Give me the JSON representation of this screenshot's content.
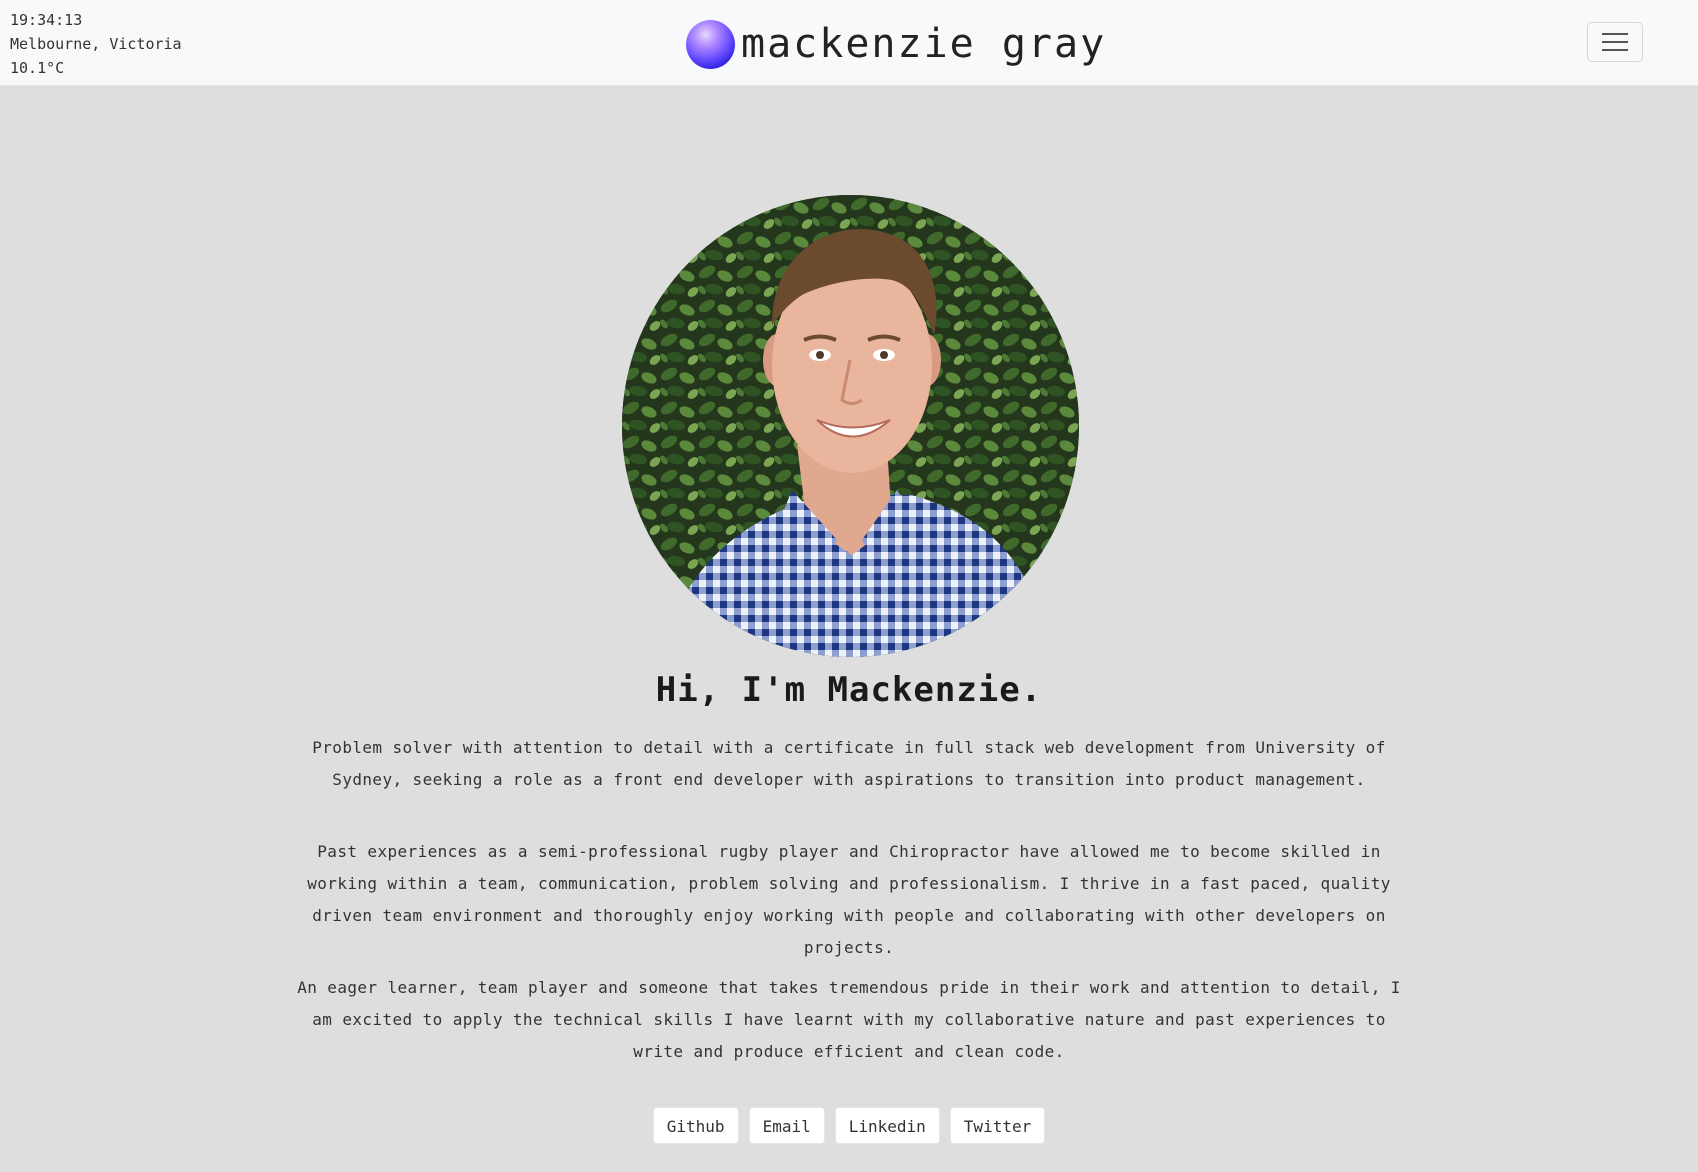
{
  "weather": {
    "time": "19:34:13",
    "location": "Melbourne, Victoria",
    "temperature": "10.1°C"
  },
  "header": {
    "brand_name": "mackenzie gray",
    "menu_icon": "hamburger-menu-icon"
  },
  "profile": {
    "photo_icon": "profile-photo"
  },
  "intro": {
    "greeting": "Hi, I'm Mackenzie.",
    "paragraph1": "Problem solver with attention to detail with a certificate in full stack web development from University of Sydney, seeking a role as a front end developer with aspirations to transition into product management.",
    "paragraph2": "Past experiences as a semi-professional rugby player and Chiropractor have allowed me to become skilled in working within a team, communication, problem solving and professionalism. I thrive in a fast paced, quality driven team environment and thoroughly enjoy working with people and collaborating with other developers on projects.",
    "paragraph3": "An eager learner, team player and someone that takes tremendous pride in their work and attention to detail, I am excited to apply the technical skills I have learnt with my collaborative nature and past experiences to write and produce efficient and clean code."
  },
  "links": {
    "github": "Github",
    "email": "Email",
    "linkedin": "Linkedin",
    "twitter": "Twitter"
  },
  "colors": {
    "page_background": "#dedede",
    "navbar_background": "#f8f9fa",
    "orb_accent": "#6a4dff"
  }
}
